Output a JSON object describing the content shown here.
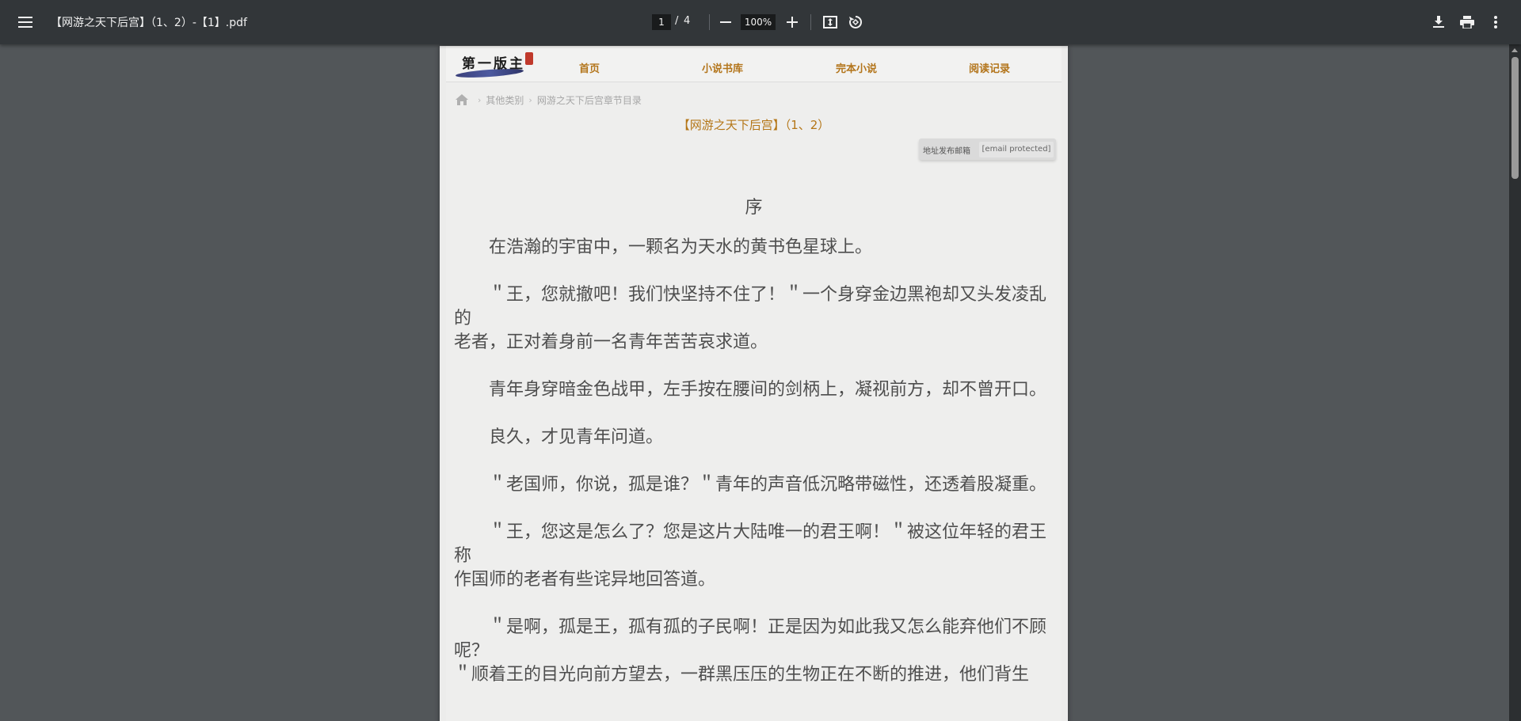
{
  "toolbar": {
    "title": "【网游之天下后宫】（1、2）-【1】.pdf",
    "page_current": "1",
    "page_separator": "/",
    "page_total": "4",
    "zoom": "100%",
    "icons": {
      "menu": "menu-icon",
      "zoom_out": "minus-icon",
      "zoom_in": "plus-icon",
      "fit": "fit-page-icon",
      "rotate": "rotate-icon",
      "download": "download-icon",
      "print": "print-icon",
      "more": "more-vert-icon"
    },
    "colors": {
      "bar": "#323639",
      "viewer_bg": "#525659",
      "text": "#f1f1f1"
    }
  },
  "page": {
    "nav": {
      "logo_text": "第一版主",
      "items": [
        "首页",
        "小说书库",
        "完本小说",
        "阅读记录"
      ],
      "accent": "#b3751b"
    },
    "breadcrumb": {
      "items": [
        "其他类别",
        "网游之天下后宫章节目录"
      ]
    },
    "chapter_title": "【网游之天下后宫】（1、2）",
    "email_notice": {
      "label": "地址发布邮箱",
      "value": "[email protected]"
    },
    "section_title": "序",
    "paragraphs": [
      "　　在浩瀚的宇宙中，一颗名为天水的黄书色星球上。",
      "　　＂王，您就撤吧！我们快坚持不住了！＂一个身穿金边黑袍却又头发凌乱的\n老者，正对着身前一名青年苦苦哀求道。",
      "　　青年身穿暗金色战甲，左手按在腰间的剑柄上，凝视前方，却不曾开口。",
      "　　良久，才见青年问道。",
      "　　＂老国师，你说，孤是谁？＂青年的声音低沉略带磁性，还透着股凝重。",
      "　　＂王，您这是怎么了？您是这片大陆唯一的君王啊！＂被这位年轻的君王称\n作国师的老者有些诧异地回答道。",
      "　　＂是啊，孤是王，孤有孤的子民啊！正是因为如此我又怎么能弃他们不顾呢？",
      "＂顺着王的目光向前方望去，一群黑压压的生物正在不断的推进，他们背生"
    ]
  }
}
